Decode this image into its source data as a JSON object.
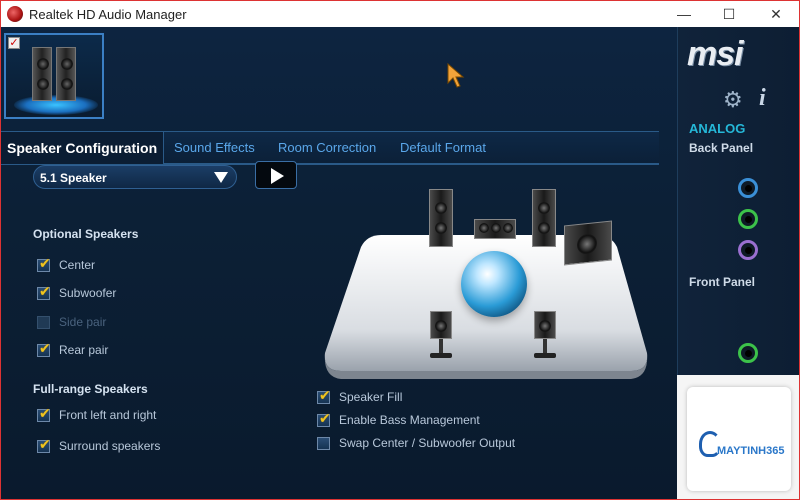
{
  "window": {
    "title": "Realtek HD Audio Manager",
    "minimize_glyph": "—",
    "maximize_glyph": "☐",
    "close_glyph": "✕"
  },
  "tabs": [
    {
      "label": "Speaker Configuration",
      "active": true
    },
    {
      "label": "Sound Effects",
      "active": false
    },
    {
      "label": "Room Correction",
      "active": false
    },
    {
      "label": "Default Format",
      "active": false
    }
  ],
  "speaker_select": {
    "value": "5.1 Speaker"
  },
  "optional_speakers": {
    "title": "Optional Speakers",
    "items": [
      {
        "label": "Center",
        "checked": true,
        "enabled": true
      },
      {
        "label": "Subwoofer",
        "checked": true,
        "enabled": true
      },
      {
        "label": "Side pair",
        "checked": false,
        "enabled": false
      },
      {
        "label": "Rear pair",
        "checked": true,
        "enabled": true
      }
    ]
  },
  "full_range": {
    "title": "Full-range Speakers",
    "items": [
      {
        "label": "Front left and right",
        "checked": true
      },
      {
        "label": "Surround speakers",
        "checked": true
      }
    ]
  },
  "bottom_options": [
    {
      "label": "Speaker Fill",
      "checked": true
    },
    {
      "label": "Enable Bass Management",
      "checked": true
    },
    {
      "label": "Swap Center / Subwoofer Output",
      "checked": false
    }
  ],
  "right_panel": {
    "brand": "msi",
    "analog_label": "ANALOG",
    "back_panel_label": "Back Panel",
    "front_panel_label": "Front Panel",
    "back_jacks": [
      "#3a8fd6",
      "#3cc24a",
      "#9a6fd0"
    ],
    "front_jacks": [
      "#3cc24a",
      "#d8d8e0"
    ]
  },
  "watermark": {
    "text": "MAYTINH365"
  },
  "colors": {
    "accent": "#2a5a88",
    "tab_text": "#5aa7ea",
    "checkmark": "#f0c420"
  }
}
